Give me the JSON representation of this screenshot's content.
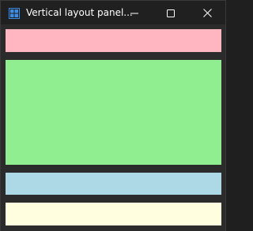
{
  "window": {
    "title": "Vertical layout panel...",
    "app_icon": "grid-app-icon",
    "controls": {
      "minimize": "minimize-icon",
      "maximize": "maximize-icon",
      "close": "close-icon"
    }
  },
  "panels": [
    {
      "name": "pink-panel",
      "color": "#ffb6c1"
    },
    {
      "name": "green-panel",
      "color": "#90ee90"
    },
    {
      "name": "blue-panel",
      "color": "#add8e6"
    },
    {
      "name": "yellow-panel",
      "color": "#ffffe0"
    }
  ],
  "theme": {
    "titlebar": "#202020",
    "background": "#2b2b2b",
    "accent": "#3b8ee8"
  }
}
